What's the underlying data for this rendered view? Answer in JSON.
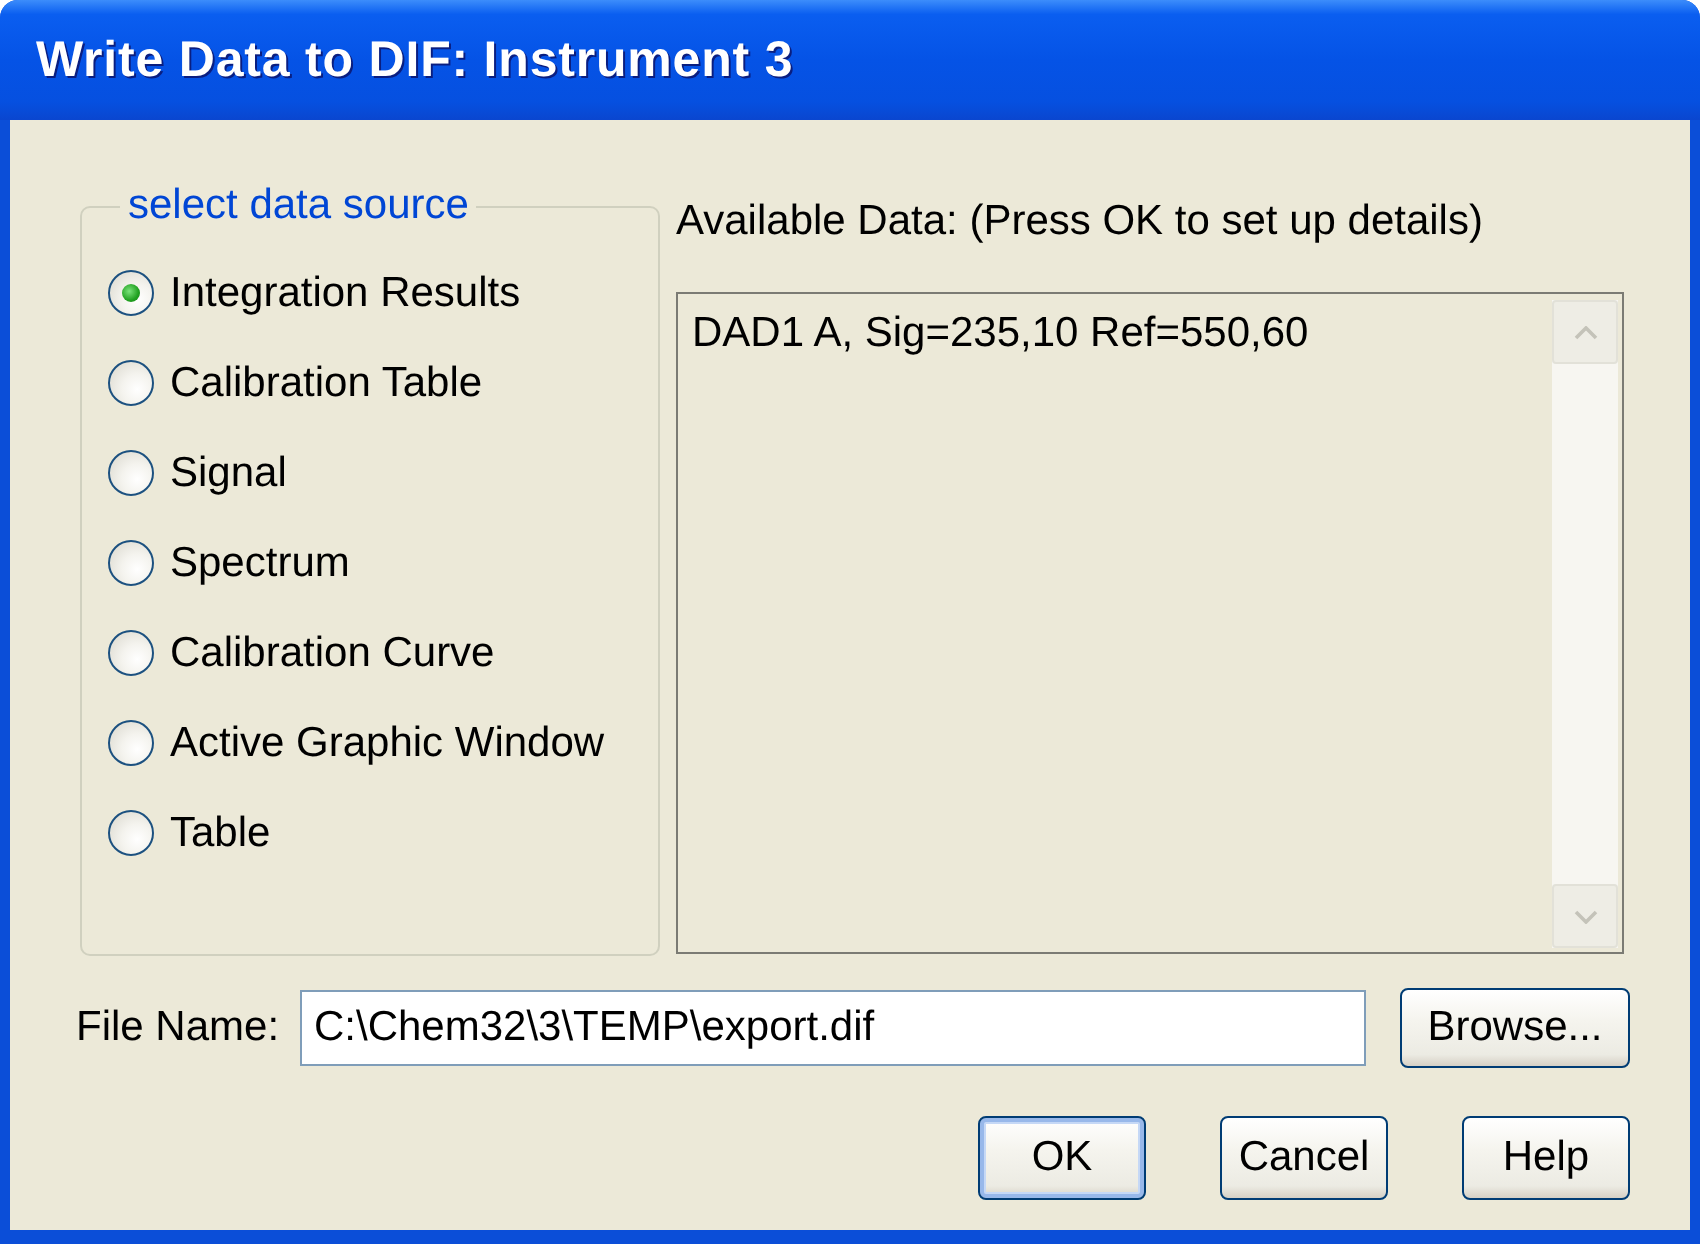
{
  "window": {
    "title": "Write Data to DIF: Instrument 3"
  },
  "data_source": {
    "legend": "select data source",
    "options": [
      {
        "label": "Integration Results",
        "selected": true
      },
      {
        "label": "Calibration Table",
        "selected": false
      },
      {
        "label": "Signal",
        "selected": false
      },
      {
        "label": "Spectrum",
        "selected": false
      },
      {
        "label": "Calibration Curve",
        "selected": false
      },
      {
        "label": "Active Graphic Window",
        "selected": false
      },
      {
        "label": "Table",
        "selected": false
      }
    ]
  },
  "available_data": {
    "label": "Available Data: (Press OK to set up details)",
    "items": [
      "DAD1 A, Sig=235,10 Ref=550,60"
    ]
  },
  "file_name": {
    "label": "File Name:",
    "value": "C:\\Chem32\\3\\TEMP\\export.dif",
    "browse_button": "Browse..."
  },
  "buttons": [
    {
      "label": "OK",
      "default": true
    },
    {
      "label": "Cancel",
      "default": false
    },
    {
      "label": "Help",
      "default": false
    }
  ]
}
